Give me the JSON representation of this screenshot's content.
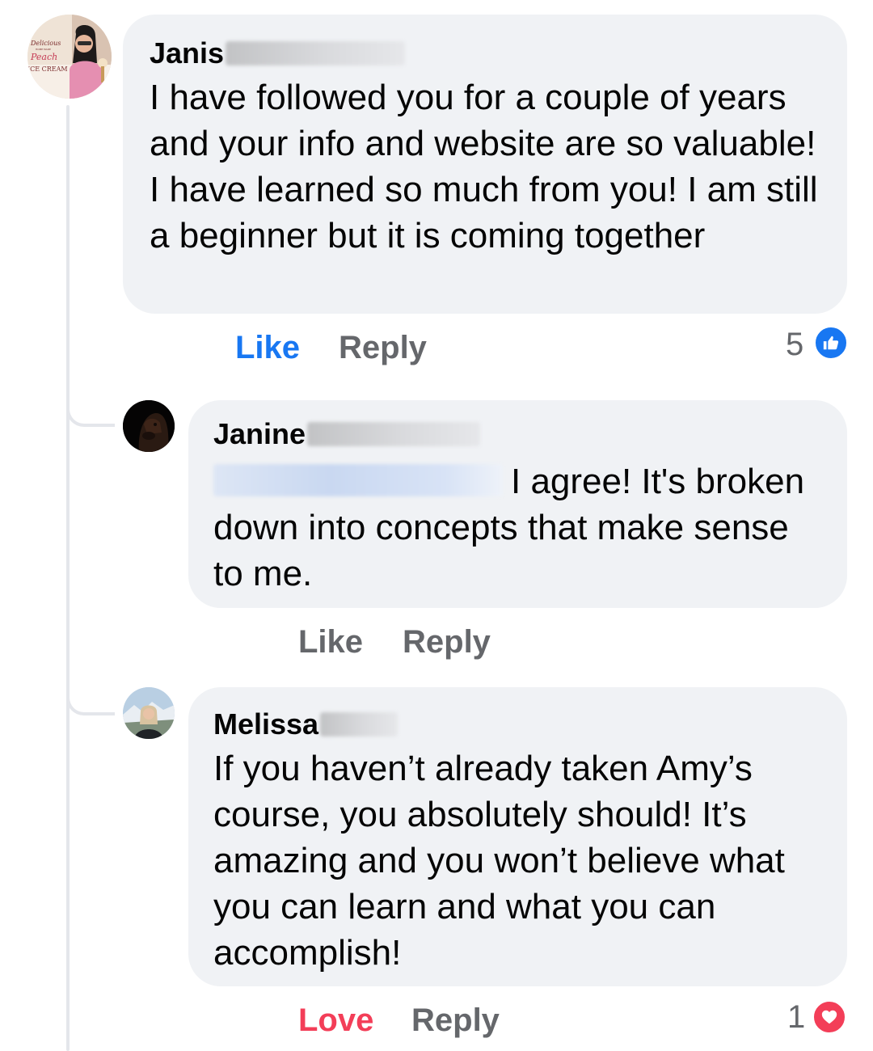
{
  "comments": [
    {
      "author_first": "Janis",
      "text": "I have followed you for a couple of years and your info and website are so valuable! I have learned so much from you! I am still a beginner but it is coming together",
      "actions": {
        "like": "Like",
        "reply": "Reply"
      },
      "reaction_count": "5",
      "reaction_icon": "like-icon"
    },
    {
      "author_first": "Janine",
      "text": "I agree! It's broken down into concepts that make sense to me.",
      "actions": {
        "like": "Like",
        "reply": "Reply"
      }
    },
    {
      "author_first": "Melissa",
      "text": "If you haven’t already taken Amy’s course, you absolutely should! It’s amazing and you won’t believe what you can learn and what you can accomplish!",
      "actions": {
        "love": "Love",
        "reply": "Reply"
      },
      "reaction_count": "1",
      "reaction_icon": "love-icon"
    }
  ],
  "avatar_janis_sign": {
    "line1": "Delicious",
    "line2": "HOME MADE",
    "line3": "Peach",
    "line4": "ICE CREAM"
  },
  "colors": {
    "bubble": "#f0f2f5",
    "like_blue": "#1877f2",
    "love_red": "#f33e58",
    "action_gray": "#65676b"
  }
}
